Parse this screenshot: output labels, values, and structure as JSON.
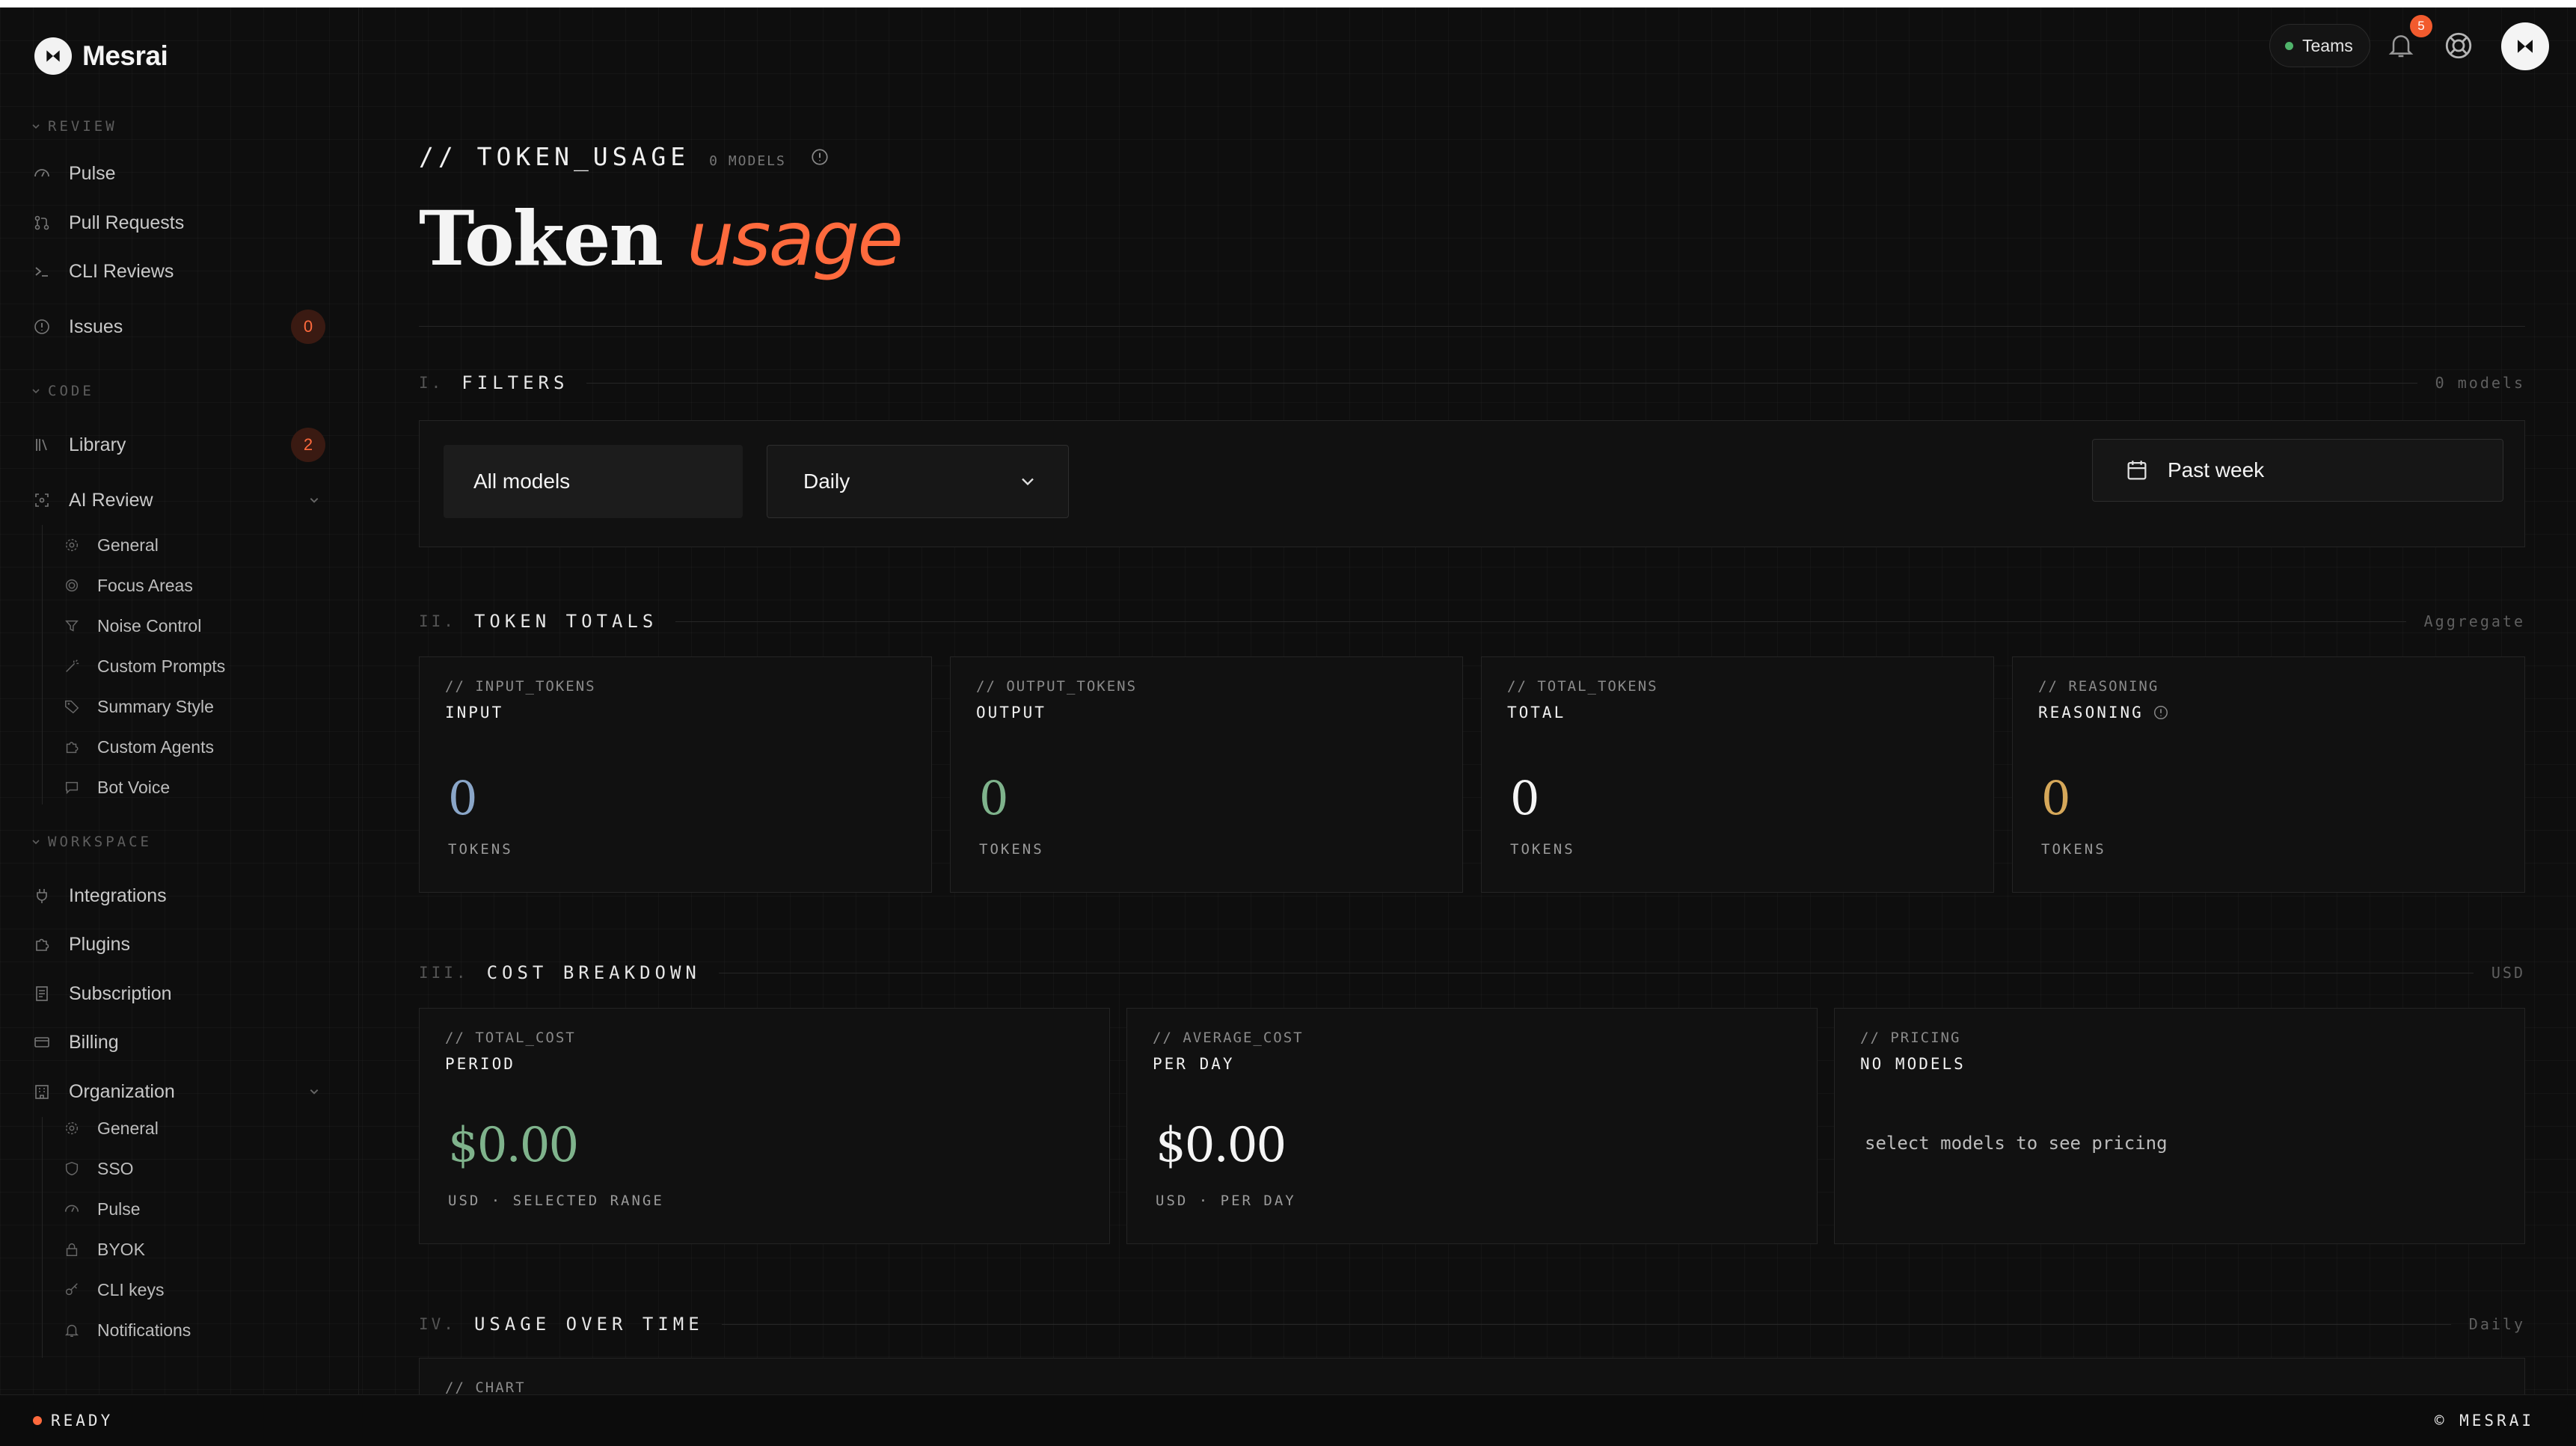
{
  "app": {
    "name": "Mesrai"
  },
  "header": {
    "teams_label": "Teams",
    "notification_count": "5"
  },
  "sidebar": {
    "sections": {
      "review": "REVIEW",
      "code": "CODE",
      "workspace": "WORKSPACE"
    },
    "review_items": [
      {
        "label": "Pulse",
        "icon": "pulse-icon"
      },
      {
        "label": "Pull Requests",
        "icon": "pull-request-icon"
      },
      {
        "label": "CLI Reviews",
        "icon": "terminal-icon"
      },
      {
        "label": "Issues",
        "icon": "info-circle-icon",
        "badge": "0"
      }
    ],
    "code_items": [
      {
        "label": "Library",
        "icon": "library-icon",
        "badge": "2"
      },
      {
        "label": "AI Review",
        "icon": "ai-review-icon"
      }
    ],
    "ai_review_sub": [
      {
        "label": "General",
        "icon": "gear-icon"
      },
      {
        "label": "Focus Areas",
        "icon": "target-icon"
      },
      {
        "label": "Noise Control",
        "icon": "filter-icon"
      },
      {
        "label": "Custom Prompts",
        "icon": "wand-icon"
      },
      {
        "label": "Summary Style",
        "icon": "tag-icon"
      },
      {
        "label": "Custom Agents",
        "icon": "puzzle-icon"
      },
      {
        "label": "Bot Voice",
        "icon": "message-icon"
      }
    ],
    "workspace_items": [
      {
        "label": "Integrations",
        "icon": "plug-icon"
      },
      {
        "label": "Plugins",
        "icon": "puzzle-icon"
      },
      {
        "label": "Subscription",
        "icon": "receipt-icon"
      },
      {
        "label": "Billing",
        "icon": "card-icon"
      },
      {
        "label": "Organization",
        "icon": "building-icon"
      }
    ],
    "org_sub": [
      {
        "label": "General",
        "icon": "gear-icon"
      },
      {
        "label": "SSO",
        "icon": "shield-icon"
      },
      {
        "label": "Pulse",
        "icon": "pulse-icon"
      },
      {
        "label": "BYOK",
        "icon": "lock-icon"
      },
      {
        "label": "CLI keys",
        "icon": "key-icon"
      },
      {
        "label": "Notifications",
        "icon": "bell-icon"
      }
    ]
  },
  "page": {
    "slug": "// TOKEN_USAGE",
    "model_count": "0 MODELS",
    "title_plain": "Token",
    "title_accent": "usage"
  },
  "sections": {
    "filters": {
      "num": "I.",
      "title": "FILTERS",
      "meta": "0 models"
    },
    "totals": {
      "num": "II.",
      "title": "TOKEN TOTALS",
      "meta": "Aggregate"
    },
    "cost": {
      "num": "III.",
      "title": "COST BREAKDOWN",
      "meta": "USD"
    },
    "usage": {
      "num": "IV.",
      "title": "USAGE OVER TIME",
      "meta": "Daily"
    }
  },
  "filters": {
    "model_select": "All models",
    "interval_select": "Daily",
    "date_range": "Past week"
  },
  "token_cards": [
    {
      "key": "// INPUT_TOKENS",
      "label": "INPUT",
      "value": "0",
      "unit": "TOKENS",
      "color": "#8aa6c8"
    },
    {
      "key": "// OUTPUT_TOKENS",
      "label": "OUTPUT",
      "value": "0",
      "unit": "TOKENS",
      "color": "#7fb38c"
    },
    {
      "key": "// TOTAL_TOKENS",
      "label": "TOTAL",
      "value": "0",
      "unit": "TOKENS",
      "color": "#f4f4f4"
    },
    {
      "key": "// REASONING",
      "label": "REASONING",
      "value": "0",
      "unit": "TOKENS",
      "color": "#d6a85a"
    }
  ],
  "cost_cards": {
    "total": {
      "key": "// TOTAL_COST",
      "label": "PERIOD",
      "value": "$0.00",
      "unit": "USD · SELECTED RANGE",
      "color": "#7fb38c"
    },
    "average": {
      "key": "// AVERAGE_COST",
      "label": "PER DAY",
      "value": "$0.00",
      "unit": "USD · PER DAY",
      "color": "#f4f4f4"
    },
    "pricing": {
      "key": "// PRICING",
      "label": "NO MODELS",
      "note": "select models to see pricing"
    }
  },
  "chart_panel": {
    "key": "// CHART"
  },
  "footer": {
    "status": "READY",
    "brand": "© MESRAI"
  },
  "colors": {
    "accent": "#ff6a3d",
    "background": "#0e0e0e",
    "status_ok": "#4fb36a"
  }
}
